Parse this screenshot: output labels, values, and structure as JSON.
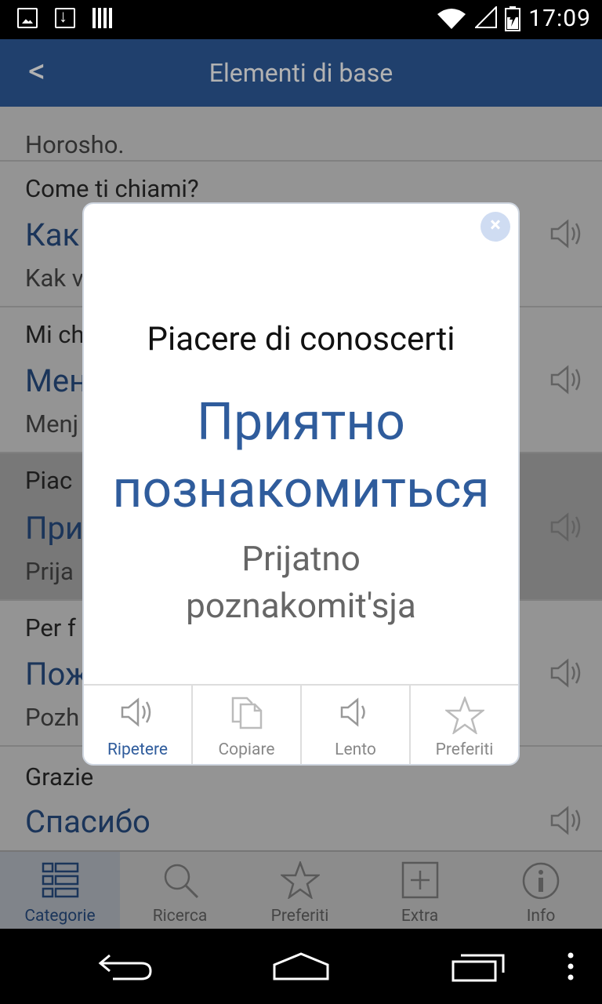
{
  "status_bar": {
    "time": "17:09"
  },
  "header": {
    "back_label": "<",
    "title": "Elementi di base"
  },
  "list": {
    "items": [
      {
        "it": "",
        "ru": "",
        "tr": "Horosho."
      },
      {
        "it": "Come ti chiami?",
        "ru": "Как",
        "tr": "Kak v"
      },
      {
        "it": "Mi ch",
        "ru": "Мен",
        "tr": "Menj"
      },
      {
        "it": "Piac",
        "ru": "При",
        "tr": "Prija"
      },
      {
        "it": "Per f",
        "ru": "Пож",
        "tr": "Pozh"
      },
      {
        "it": "Grazie",
        "ru": "Спасибо",
        "tr": ""
      }
    ]
  },
  "dialog": {
    "italian": "Piacere di conoscerti",
    "russian_line1": "Приятно",
    "russian_line2": "познакомиться",
    "translit_line1": "Prijatno",
    "translit_line2": "poznakomit'sja",
    "close_icon": "×",
    "actions": [
      {
        "label": "Ripetere",
        "icon": "speaker-icon"
      },
      {
        "label": "Copiare",
        "icon": "copy-icon"
      },
      {
        "label": "Lento",
        "icon": "speaker-slow-icon"
      },
      {
        "label": "Preferiti",
        "icon": "star-icon"
      }
    ]
  },
  "tabbar": {
    "tabs": [
      {
        "label": "Categorie",
        "icon": "list-icon"
      },
      {
        "label": "Ricerca",
        "icon": "search-icon"
      },
      {
        "label": "Preferiti",
        "icon": "star-icon"
      },
      {
        "label": "Extra",
        "icon": "plus-box-icon"
      },
      {
        "label": "Info",
        "icon": "info-icon"
      }
    ]
  },
  "colors": {
    "accent": "#2f5c9c"
  }
}
